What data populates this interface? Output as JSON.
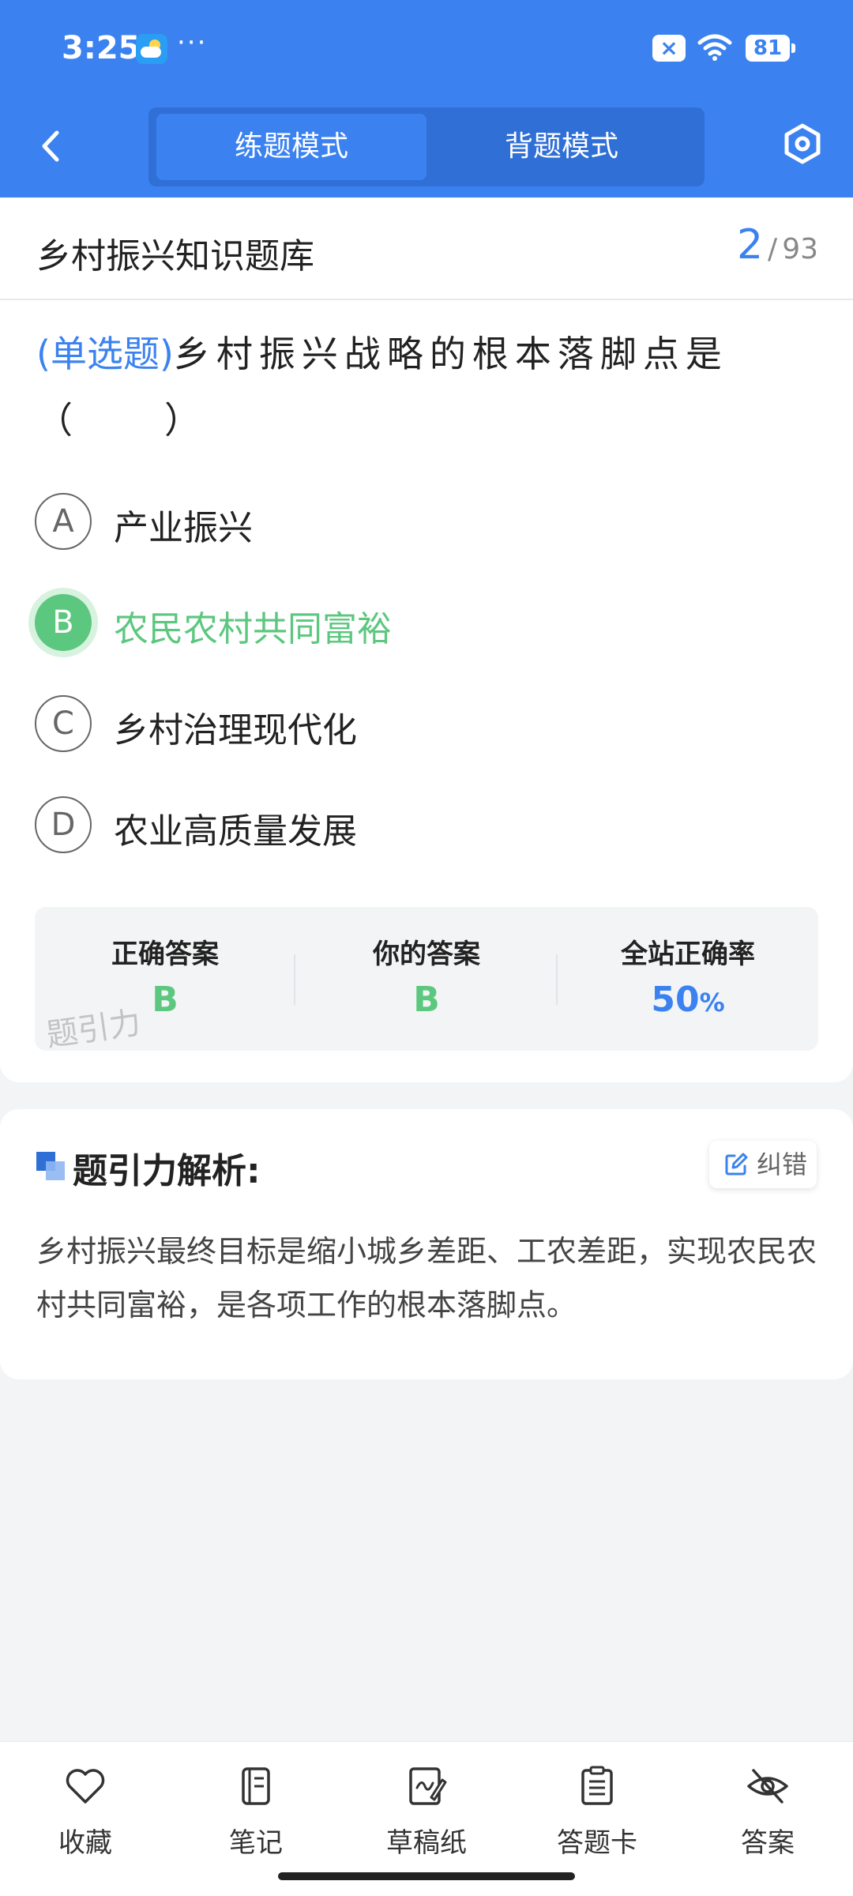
{
  "status_bar": {
    "time": "3:25",
    "more": "···",
    "battery": "81"
  },
  "header": {
    "tabs": [
      {
        "label": "练题模式",
        "active": true
      },
      {
        "label": "背题模式",
        "active": false
      }
    ]
  },
  "question": {
    "bank_title": "乡村振兴知识题库",
    "current": "2",
    "separator": "/",
    "total": "93",
    "type_label": "(单选题)",
    "text": "乡村振兴战略的根本落脚点是（　　）",
    "options": [
      {
        "key": "A",
        "text": "产业振兴",
        "state": "normal"
      },
      {
        "key": "B",
        "text": "农民农村共同富裕",
        "state": "correct"
      },
      {
        "key": "C",
        "text": "乡村治理现代化",
        "state": "normal"
      },
      {
        "key": "D",
        "text": "农业高质量发展",
        "state": "normal"
      }
    ]
  },
  "stats": {
    "correct_label": "正确答案",
    "correct_value": "B",
    "yours_label": "你的答案",
    "yours_value": "B",
    "rate_label": "全站正确率",
    "rate_value": "50",
    "rate_unit": "%",
    "watermark": "题引力"
  },
  "analysis": {
    "title": "题引力解析:",
    "report_label": "纠错",
    "text": "乡村振兴最终目标是缩小城乡差距、工农差距，实现农民农村共同富裕，是各项工作的根本落脚点。"
  },
  "bottom_nav": [
    {
      "label": "收藏",
      "icon": "heart-icon"
    },
    {
      "label": "笔记",
      "icon": "notebook-icon"
    },
    {
      "label": "草稿纸",
      "icon": "draft-icon"
    },
    {
      "label": "答题卡",
      "icon": "clipboard-icon"
    },
    {
      "label": "答案",
      "icon": "eye-off-icon"
    }
  ],
  "colors": {
    "primary": "#3b82f0",
    "correct": "#5cc77e",
    "background": "#f3f4f6"
  }
}
